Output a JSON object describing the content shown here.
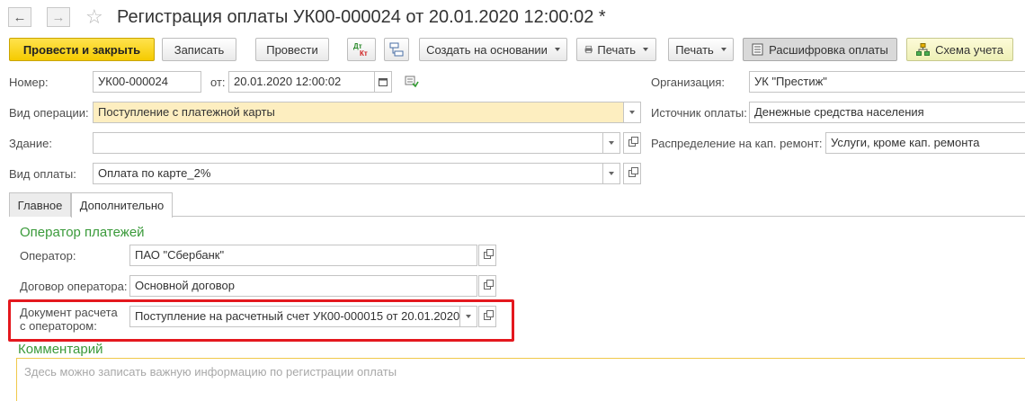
{
  "window": {
    "title": "Регистрация оплаты УК00-000024 от 20.01.2020 12:00:02 *",
    "back_icon": "arrow-left-icon",
    "forward_icon": "arrow-right-icon",
    "favorite_icon": "star-icon"
  },
  "toolbar": {
    "post_close": "Провести и закрыть",
    "save": "Записать",
    "post": "Провести",
    "create_based": "Создать на основании",
    "print1": "Печать",
    "print2": "Печать",
    "decode": "Расшифровка оплаты",
    "accounting": "Схема учета",
    "dtkt_icon": "dt-kt-icon",
    "structure_icon": "structure-icon"
  },
  "form": {
    "number_label": "Номер:",
    "number_value": "УК00-000024",
    "date_label": "от:",
    "date_value": "20.01.2020 12:00:02",
    "org_label": "Организация:",
    "org_value": "УК \"Престиж\"",
    "op_type_label": "Вид операции:",
    "op_type_value": "Поступление с платежной карты",
    "source_label": "Источник оплаты:",
    "source_value": "Денежные средства населения",
    "building_label": "Здание:",
    "building_value": "",
    "distribution_label": "Распределение на кап. ремонт:",
    "distribution_value": "Услуги, кроме кап. ремонта",
    "pay_type_label": "Вид оплаты:",
    "pay_type_value": "Оплата по карте_2%"
  },
  "tabs": [
    {
      "label": "Главное",
      "active": false
    },
    {
      "label": "Дополнительно",
      "active": true
    }
  ],
  "operator_group": {
    "title": "Оператор платежей",
    "operator_label": "Оператор:",
    "operator_value": "ПАО \"Сбербанк\"",
    "contract_label": "Договор оператора:",
    "contract_value": "Основной договор",
    "doc_label_line1": "Документ расчета",
    "doc_label_line2": "с оператором:",
    "doc_value": "Поступление на расчетный счет УК00-000015 от 20.01.2020"
  },
  "comment": {
    "title": "Комментарий",
    "placeholder": "Здесь можно записать важную информацию по регистрации оплаты"
  },
  "colors": {
    "primary_button": "#f5cb00",
    "group_title": "#3a9a3a",
    "highlight_frame": "#e4181e",
    "required_field": "#fdeec0"
  }
}
